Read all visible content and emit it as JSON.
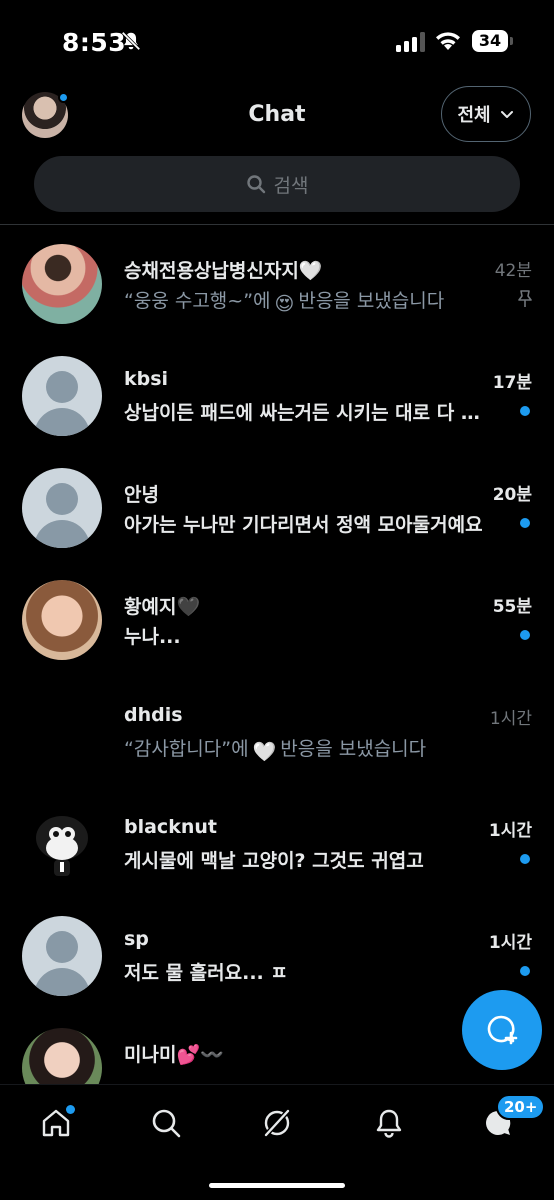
{
  "status_bar": {
    "time": "8:53",
    "battery": "34"
  },
  "header": {
    "title": "Chat",
    "filter_label": "전체",
    "search_placeholder": "검색"
  },
  "conversations": [
    {
      "name": "승채전용상납병신자지🤍",
      "time": "42분",
      "message_pre": "“웅웅 수고행~”에",
      "message_post": "반응을 보냈습니다",
      "reaction": "😍",
      "avatar": "photo",
      "unread": false,
      "pinned": true
    },
    {
      "name": "kbsi",
      "time": "17분",
      "message": "상납이든 패드에 싸는거든 시키는 대로 다 할게요",
      "avatar": "default",
      "unread": true
    },
    {
      "name": "안녕",
      "time": "20분",
      "message": "아가는 누나만 기다리면서 정액 모아둘거예요",
      "avatar": "default",
      "unread": true
    },
    {
      "name": "황예지🖤",
      "time": "55분",
      "message": "누나...",
      "avatar": "photo",
      "unread": true
    },
    {
      "name": "dhdis",
      "time": "1시간",
      "message_pre": "“감사합니다”에",
      "message_post": "반응을 보냈습니다",
      "reaction": "🤍",
      "avatar": "none",
      "unread": false
    },
    {
      "name": "blacknut",
      "time": "1시간",
      "message": "게시물에 맥날 고양이? 그것도 귀엽고",
      "avatar": "character",
      "unread": true
    },
    {
      "name": "sp",
      "time": "1시간",
      "message": "저도 물 흘러요... ㅍ",
      "avatar": "default",
      "unread": true
    },
    {
      "name": "미나미💕〰️",
      "time": "",
      "message": "",
      "avatar": "photo",
      "unread": false
    }
  ],
  "bottom_nav": {
    "items": [
      "home-icon",
      "search-icon",
      "grok-icon",
      "notifications-icon",
      "messages-icon"
    ],
    "messages_badge": "20+"
  },
  "colors": {
    "accent": "#1d9bf0",
    "background": "#000000",
    "muted": "#71767b"
  }
}
